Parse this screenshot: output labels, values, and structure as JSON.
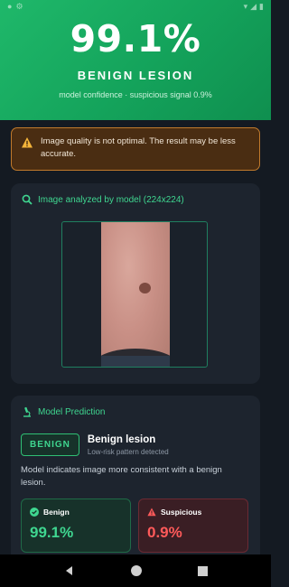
{
  "colors": {
    "accent_green": "#3fd690",
    "hero_green": "#14a35b",
    "warning_bg": "#4a2d12",
    "suspicious_red": "#ff5a5a",
    "background": "#141a22"
  },
  "hero": {
    "value": "99.1%",
    "title": "BENIGN LESION",
    "subtitle": "model confidence · suspicious signal 0.9%"
  },
  "warning": {
    "icon": "warning-icon",
    "text": "Image quality is not optimal. The result may be less accurate."
  },
  "image_card": {
    "icon": "search-icon",
    "title": "Image analyzed by model (224x224)"
  },
  "prediction_card": {
    "icon": "microscope-icon",
    "title": "Model Prediction",
    "pill": "BENIGN",
    "result_title": "Benign lesion",
    "result_sub": "Low-risk pattern detected",
    "description": "Model indicates image more consistent with a benign lesion.",
    "metrics": [
      {
        "label": "Benign",
        "value": "99.1%",
        "icon": "check-circle-icon"
      },
      {
        "label": "Suspicious",
        "value": "0.9%",
        "icon": "alert-triangle-icon"
      }
    ]
  },
  "navbar": {
    "items": [
      "back-icon",
      "home-icon",
      "recents-icon"
    ]
  }
}
